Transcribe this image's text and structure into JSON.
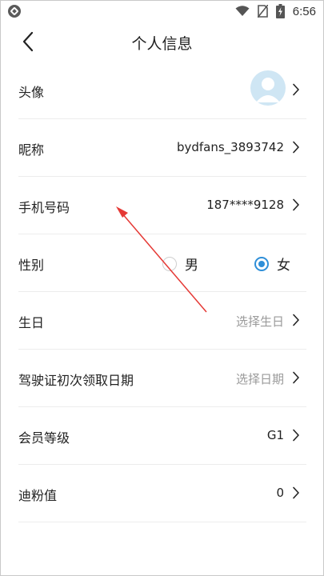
{
  "status_bar": {
    "time": "6:56"
  },
  "header": {
    "title": "个人信息"
  },
  "rows": [
    {
      "label": "头像",
      "value": ""
    },
    {
      "label": "昵称",
      "value": "bydfans_3893742"
    },
    {
      "label": "手机号码",
      "value": "187****9128"
    },
    {
      "label": "性别",
      "options": [
        "男",
        "女"
      ],
      "selected": "女"
    },
    {
      "label": "生日",
      "value": "选择生日"
    },
    {
      "label": "驾驶证初次领取日期",
      "value": "选择日期"
    },
    {
      "label": "会员等级",
      "value": "G1"
    },
    {
      "label": "迪粉值",
      "value": "0"
    }
  ],
  "icons": {
    "back": "chevron-left-icon",
    "row_arrow": "chevron-right-icon",
    "avatar": "default-avatar-icon"
  },
  "colors": {
    "accent": "#2f8fd8",
    "annotation_arrow": "#e53935",
    "placeholder": "#9a9a9a"
  }
}
